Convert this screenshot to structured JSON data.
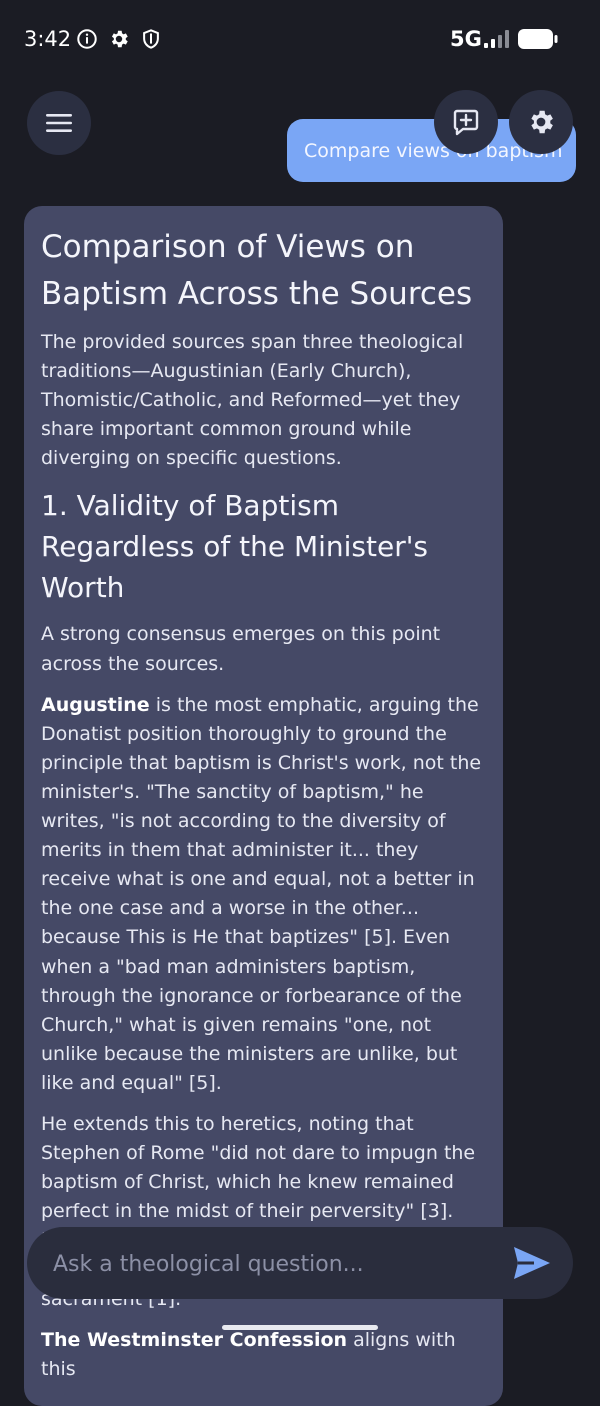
{
  "status_bar": {
    "time": "3:42",
    "network": "5G",
    "icons": [
      "info-icon",
      "gear-icon",
      "shield-icon",
      "signal-icon",
      "battery-icon"
    ]
  },
  "header": {
    "menu_icon": "hamburger-menu-icon",
    "new_chat_icon": "add-box-icon",
    "settings_icon": "gear-icon"
  },
  "conversation": {
    "user_message": "Compare views on baptism",
    "assistant": {
      "title": "Comparison of Views on Baptism Across the Sources",
      "intro": "The provided sources span three theological traditions—Augustinian (Early Church), Thomistic/Catholic, and Reformed—yet they share important common ground while diverging on specific questions.",
      "section1_heading": "1. Validity of Baptism Regardless of the Minister's Worth",
      "section1_p1": "A strong consensus emerges on this point across the sources.",
      "augustine_name": "Augustine",
      "section1_p2_rest": " is the most emphatic, arguing the Donatist position thoroughly to ground the principle that baptism is Christ's work, not the minister's. \"The sanctity of baptism,\" he writes, \"is not according to the diversity of merits in them that administer it... they receive what is one and equal, not a better in the one case and a worse in the other... because This is He that baptizes\" [5]. Even when a \"bad man administers baptism, through the ignorance or forbearance of the Church,\" what is given remains \"one, not unlike because the ministers are unlike, but like and equal\" [5].",
      "section1_p3": "He extends this to heretics, noting that Stephen of Rome \"did not dare to impugn the baptism of Christ, which he knew remained perfect in the midst of their perversity\" [3]. For Augustine, even those within the Church who hold heretical views do not invalidate the sacrament [1].",
      "westminster_name": "The Westminster Confession",
      "section1_p4_rest": " aligns with this"
    }
  },
  "composer": {
    "placeholder": "Ask a theological question...",
    "send_icon": "send-icon"
  },
  "colors": {
    "background": "#1b1c24",
    "user_bubble": "#7aa6f5",
    "assistant_bubble": "#454966",
    "accent_send": "#7aa6f5"
  }
}
